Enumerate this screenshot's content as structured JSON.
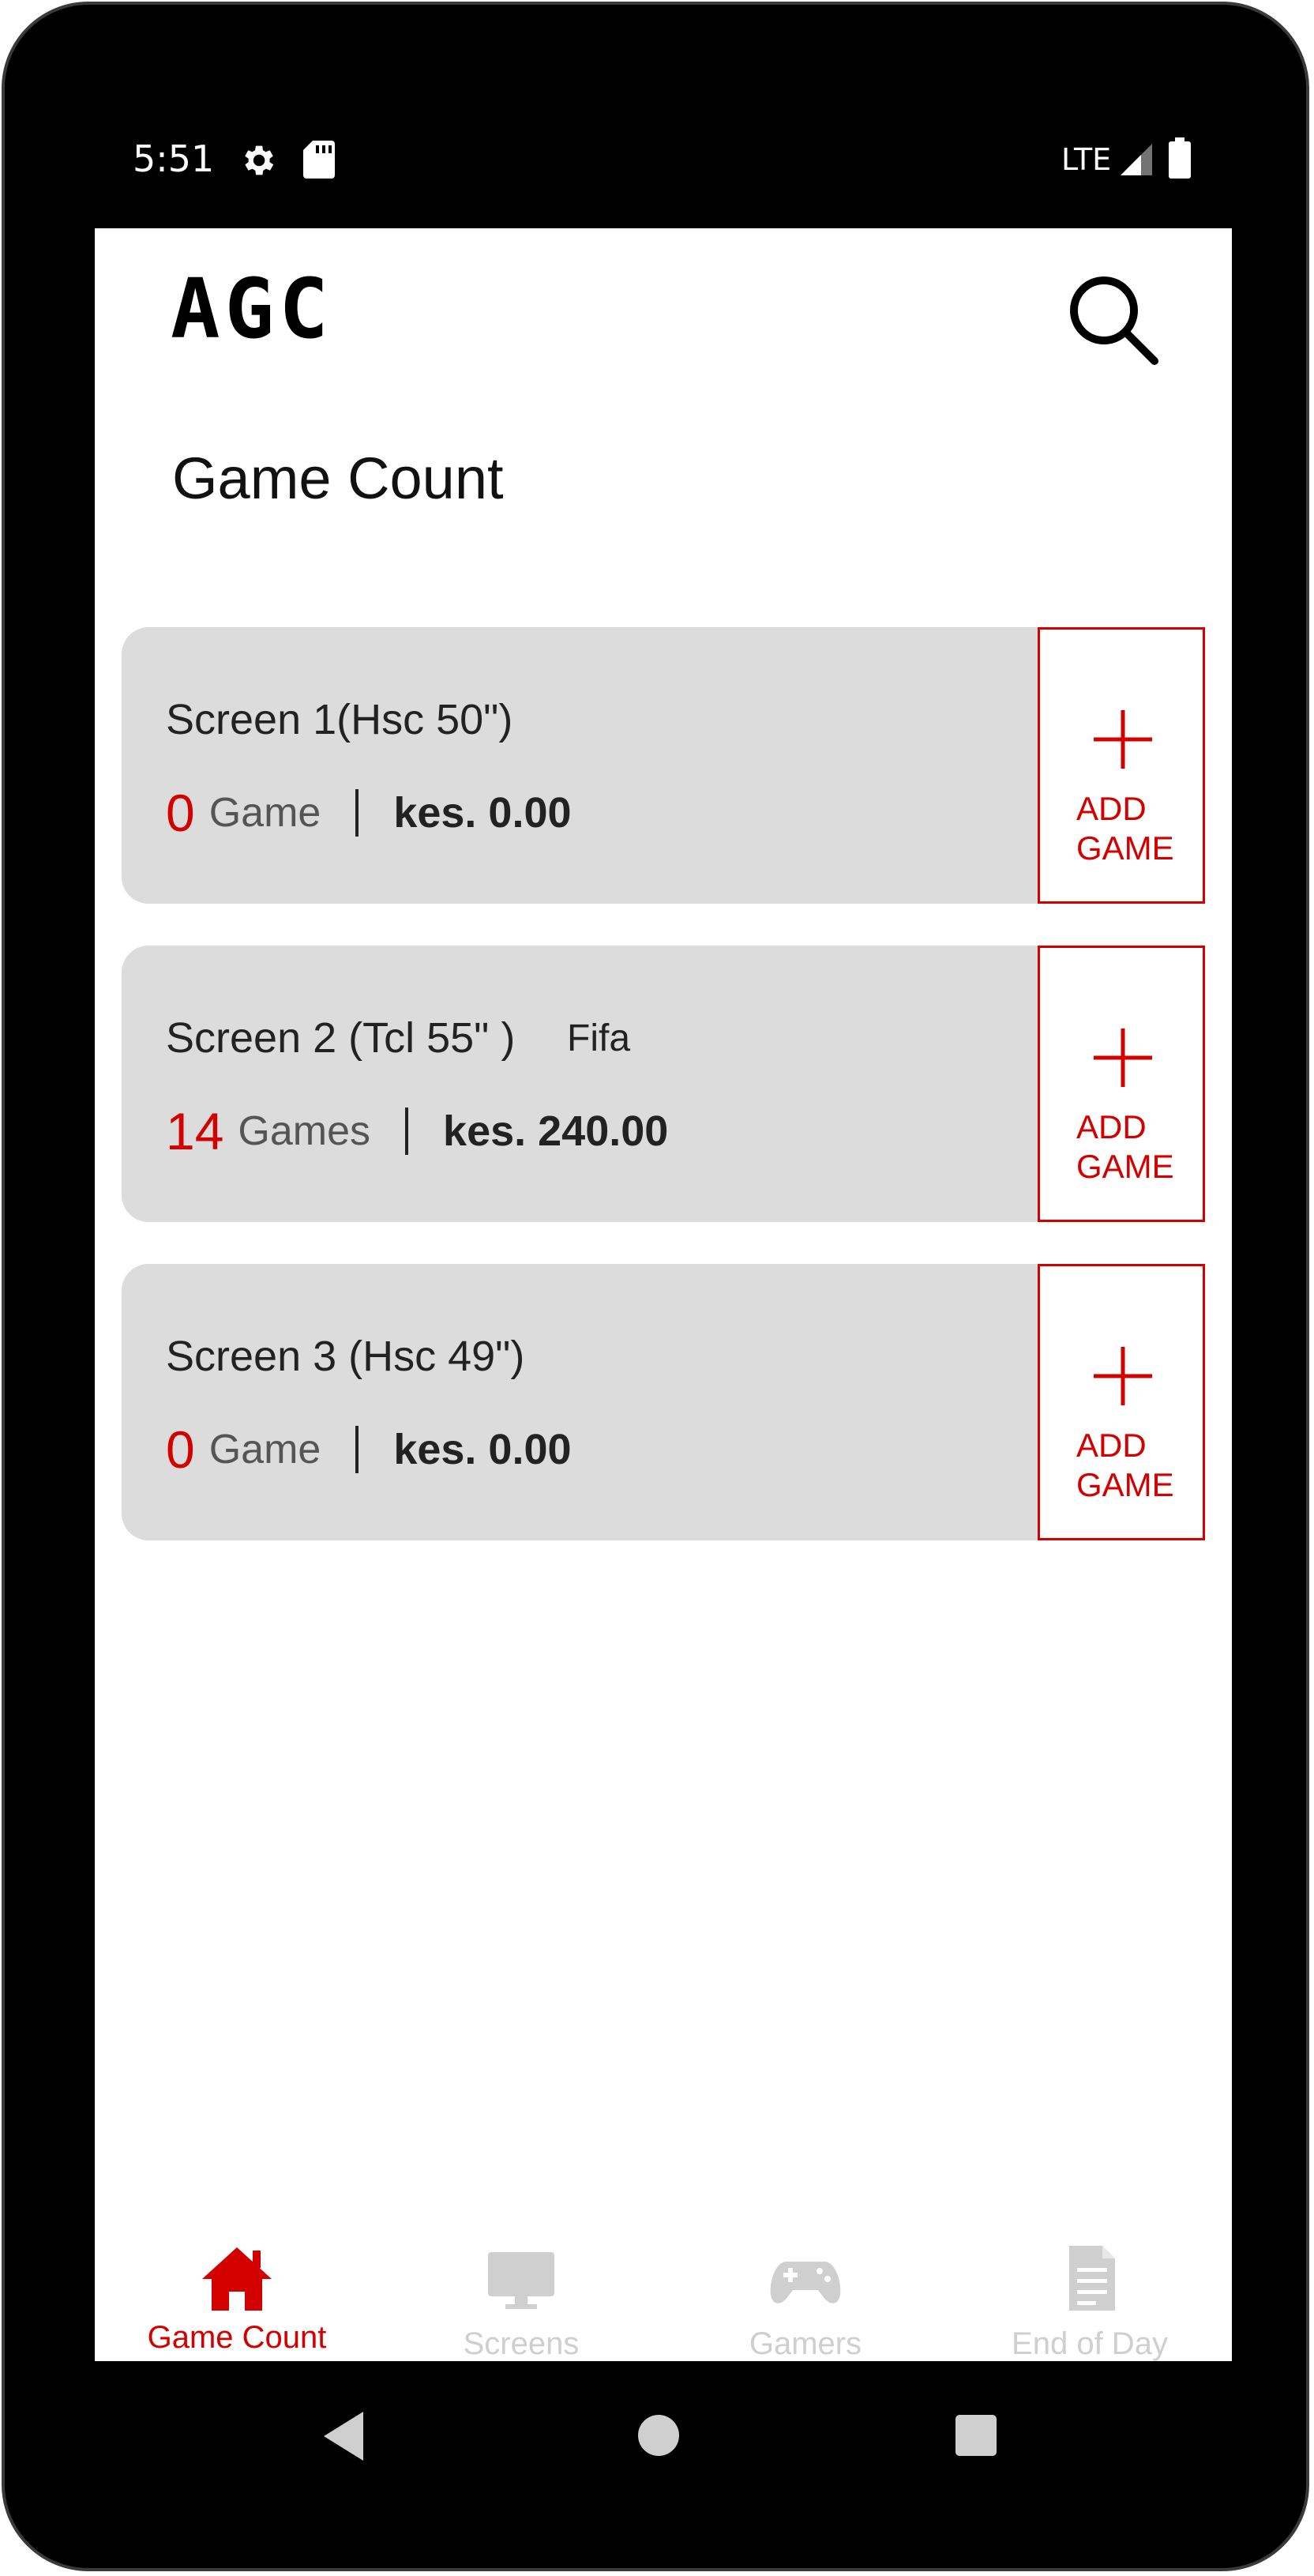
{
  "status_bar": {
    "time": "5:51",
    "network": "LTE",
    "icons": [
      "gear-icon",
      "sd-card-icon",
      "signal-icon",
      "battery-icon"
    ]
  },
  "header": {
    "logo": "AGC",
    "search_icon": "search-icon"
  },
  "page": {
    "title": "Game Count"
  },
  "screens": [
    {
      "name": "Screen 1(Hsc 50\")",
      "tag": "",
      "count": "0",
      "unit": "Game",
      "amount": "kes. 0.00",
      "add_label": "ADD GAME"
    },
    {
      "name": "Screen 2 (Tcl 55\" )",
      "tag": "Fifa",
      "count": "14",
      "unit": "Games",
      "amount": "kes. 240.00",
      "add_label": "ADD GAME"
    },
    {
      "name": "Screen 3 (Hsc 49\")",
      "tag": "",
      "count": "0",
      "unit": "Game",
      "amount": "kes. 0.00",
      "add_label": "ADD GAME"
    }
  ],
  "bottom_nav": {
    "items": [
      {
        "label": "Game Count",
        "icon": "home-icon",
        "active": true
      },
      {
        "label": "Screens",
        "icon": "monitor-icon",
        "active": false
      },
      {
        "label": "Gamers",
        "icon": "gamepad-icon",
        "active": false
      },
      {
        "label": "End of Day",
        "icon": "report-icon",
        "active": false
      }
    ]
  },
  "colors": {
    "accent": "#d30000",
    "card_bg": "#dcdcdc",
    "inactive": "#cfcfcf"
  }
}
